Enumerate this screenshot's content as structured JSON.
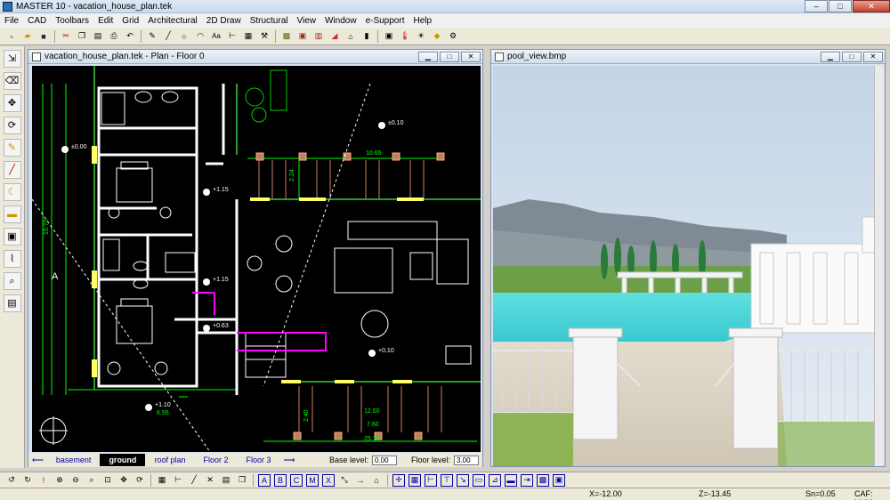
{
  "app": {
    "title": "MASTER 10 - vacation_house_plan.tek"
  },
  "window_controls": {
    "minimize": "–",
    "maximize": "□",
    "close": "✕"
  },
  "menu": [
    "File",
    "CAD",
    "Toolbars",
    "Edit",
    "Grid",
    "Architectural",
    "2D Draw",
    "Structural",
    "View",
    "Window",
    "e-Support",
    "Help"
  ],
  "plan_window": {
    "title": "vacation_house_plan.tek - Plan - Floor 0",
    "floors": [
      "basement",
      "ground",
      "roof plan",
      "Floor 2",
      "Floor 3"
    ],
    "active_floor": "ground",
    "base_level_label": "Base level:",
    "base_level_value": "0.00",
    "floor_level_label": "Floor level:",
    "floor_level_value": "3.00",
    "labels": {
      "elev_000": "±0.00",
      "elev_010": "±0.10",
      "elev_115a": "+1.15",
      "elev_115b": "+1.15",
      "elev_063": "+0.63",
      "elev_010b": "+0.10",
      "elev_110": "+1.10",
      "dim_1065": "10.65",
      "dim_224": "2.24",
      "dim_1570": "15.70",
      "dim_1200": "12.00",
      "dim_760": "7.60",
      "dim_240": "2.40",
      "dim_2510": "25.10",
      "dim_655": "6.55",
      "section_a": "A"
    }
  },
  "pool_window": {
    "title": "pool_view.bmp"
  },
  "status": {
    "x": "X=-12.00",
    "z": "Z=-13.45",
    "sn": "Sn=0.05",
    "caf": "CAF: NUM"
  },
  "icons": {
    "toolbar": [
      "new-icon",
      "open-icon",
      "save-icon",
      "cut-icon",
      "copy-icon",
      "paste-icon",
      "print-icon",
      "undo-icon",
      "pencil-icon",
      "line-icon",
      "circle-icon",
      "arc-icon",
      "text-icon",
      "dimension-icon",
      "hatch-icon",
      "hammer-icon",
      "wall-icon",
      "window-icon",
      "door-icon",
      "stair-icon",
      "roof-icon",
      "column-icon",
      "render-icon",
      "thermometer-icon",
      "light-icon",
      "sun-icon",
      "camera-icon"
    ],
    "left": [
      "select-icon",
      "eraser-icon",
      "move-icon",
      "rotate-icon",
      "pen-icon",
      "measure-icon",
      "moon-icon",
      "layer-icon",
      "block-icon",
      "pipette-icon",
      "zoom-icon",
      "text-block-icon"
    ],
    "bottom": [
      "undo-icon",
      "redo-icon",
      "snap-icon",
      "zoom-in-icon",
      "zoom-out-icon",
      "zoom-window-icon",
      "zoom-all-icon",
      "pan-icon",
      "regen-icon",
      "grid-icon",
      "ortho-icon",
      "polar-icon",
      "osnap-icon",
      "layer-icon",
      "copy-icon",
      "text-a-icon",
      "text-b-icon",
      "text-c-icon",
      "mirror-icon",
      "explode-icon",
      "stretch-icon",
      "dim-icon",
      "mouse-icon",
      "crosshair-icon",
      "grid2-icon",
      "grid3-icon",
      "grid4-icon",
      "grid5-icon",
      "grid6-icon",
      "grid7-icon",
      "grid8-icon",
      "grid9-icon",
      "grid10-icon",
      "grid11-icon"
    ]
  },
  "colors": {
    "plan_bg": "#000000",
    "wall": "#ffffff",
    "dim": "#00ff00",
    "stair": "#ff00ff",
    "column": "#c08060",
    "pool": "#40d0d0",
    "sky": "#c8dcef"
  }
}
